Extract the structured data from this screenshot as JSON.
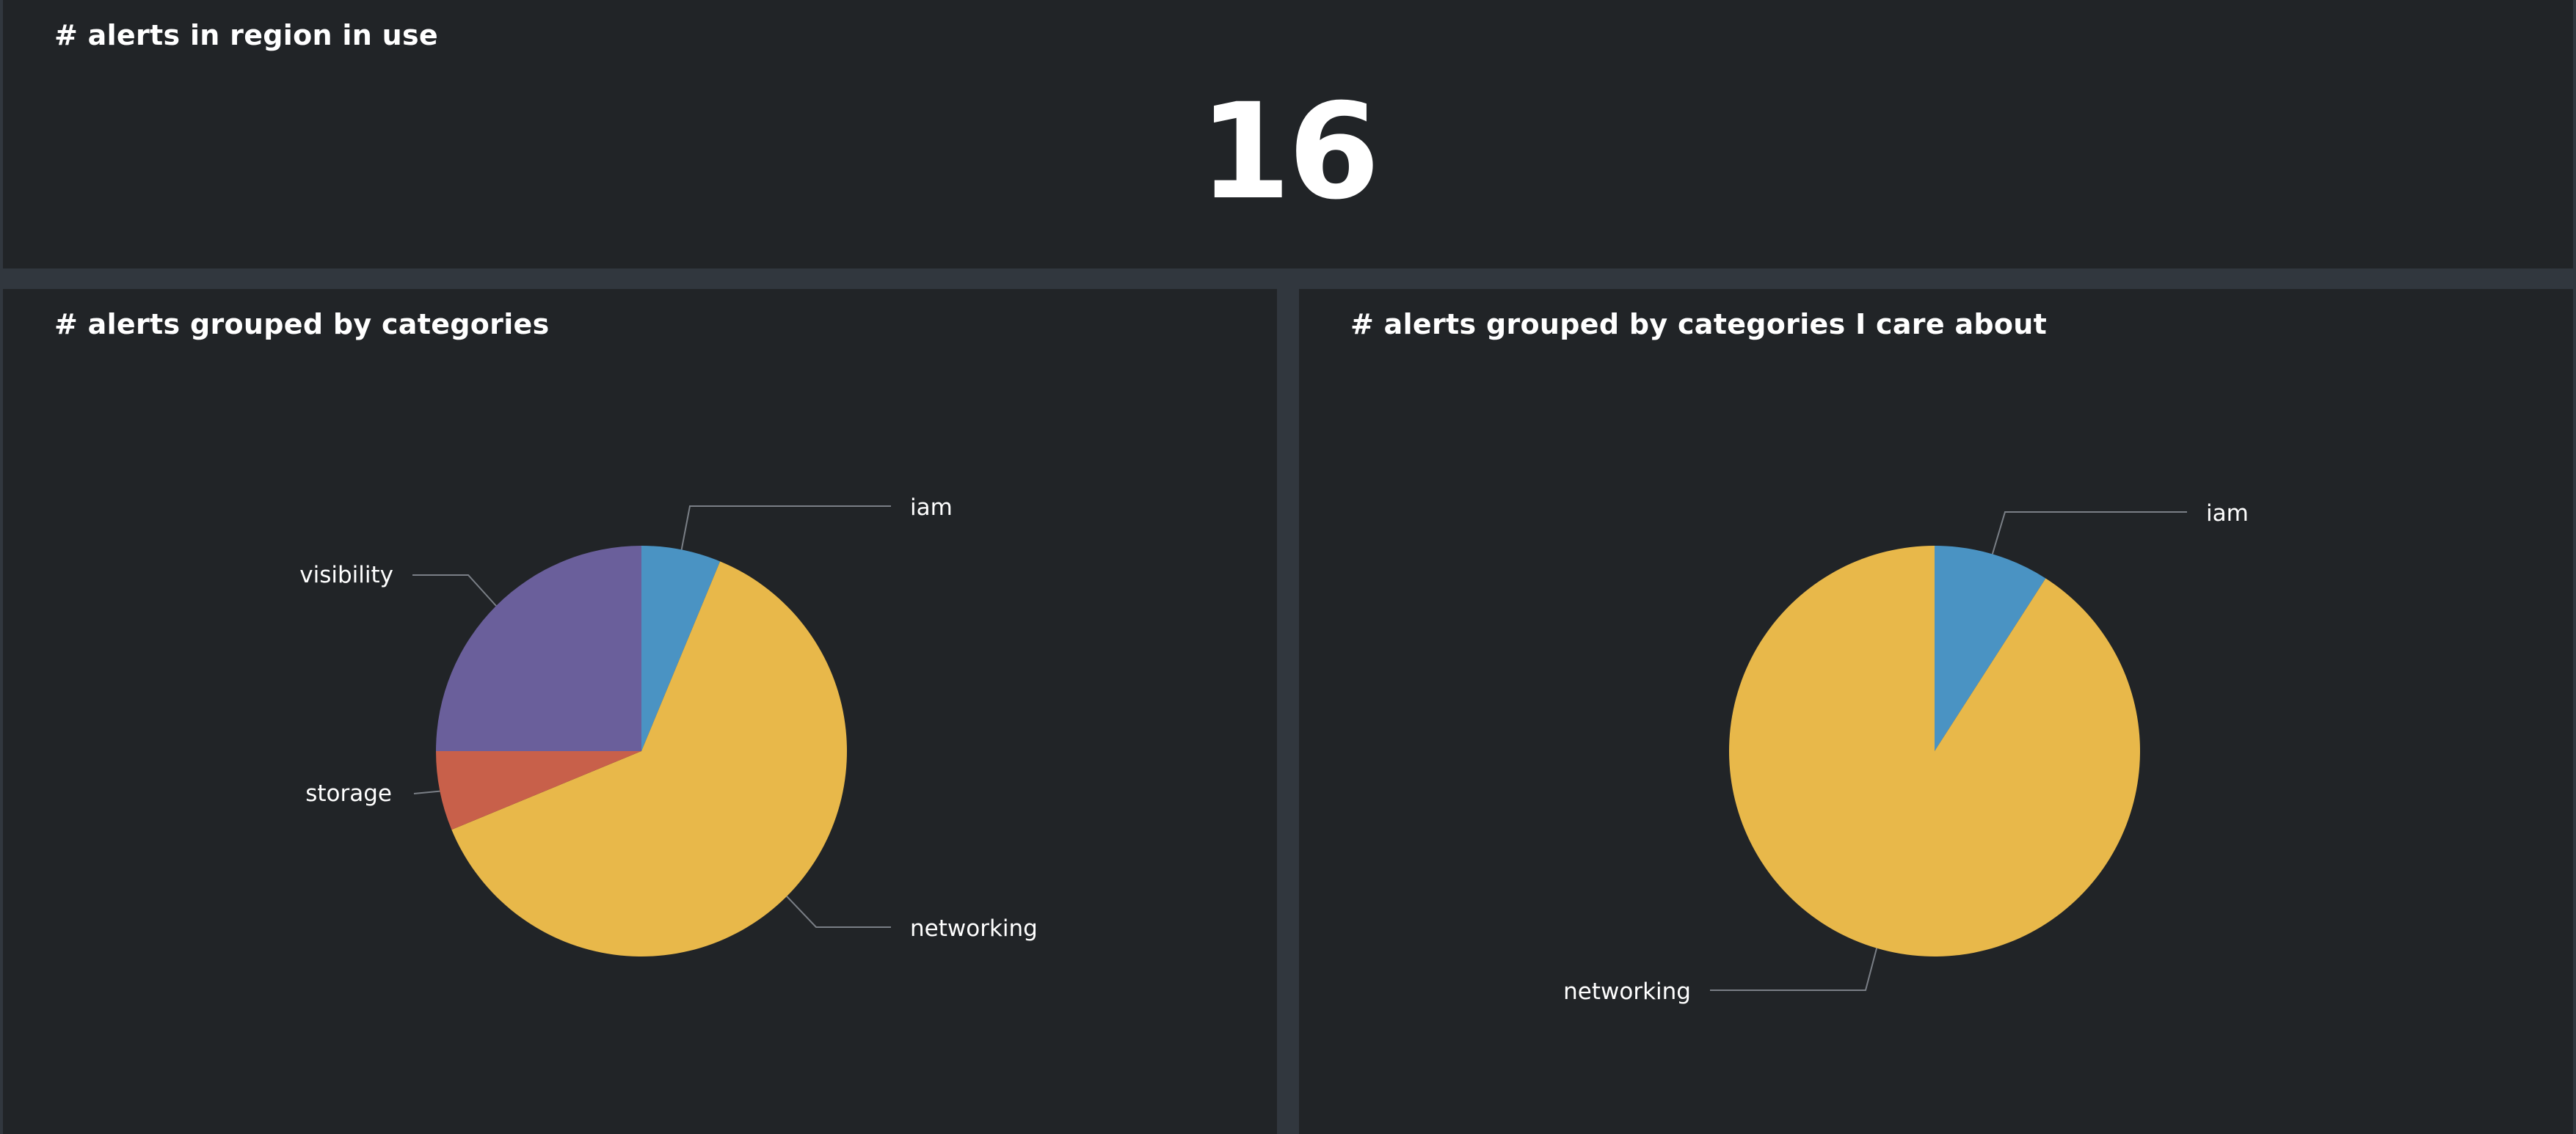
{
  "panels": {
    "top": {
      "title": "# alerts in region in use",
      "value": "16"
    },
    "left": {
      "title": "# alerts grouped by categories"
    },
    "right": {
      "title": "# alerts grouped by categories I care about"
    }
  },
  "colors": {
    "iam": "#4a93c3",
    "networking": "#e8b84a",
    "storage": "#c8604a",
    "visibility": "#6a5f9b",
    "panel_bg": "#212427",
    "dashboard_bg": "#31373e",
    "text": "#ffffff",
    "leader_line": "#7a7f86"
  },
  "chart_data": [
    {
      "type": "pie",
      "title": "# alerts grouped by categories",
      "categories": [
        "iam",
        "networking",
        "storage",
        "visibility"
      ],
      "values": [
        1,
        10,
        1,
        4
      ],
      "slice_order": [
        "iam",
        "networking",
        "storage",
        "visibility"
      ],
      "start_angle": "12 o'clock",
      "direction": "clockwise"
    },
    {
      "type": "pie",
      "title": "# alerts grouped by categories I care about",
      "categories": [
        "iam",
        "networking"
      ],
      "values": [
        1,
        10
      ],
      "slice_order": [
        "iam",
        "networking"
      ],
      "start_angle": "12 o'clock",
      "direction": "clockwise"
    }
  ]
}
